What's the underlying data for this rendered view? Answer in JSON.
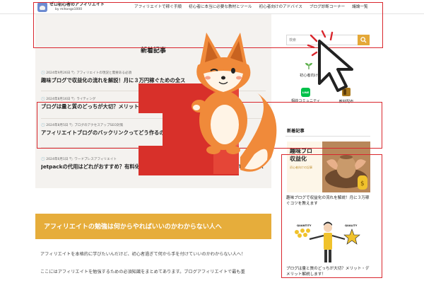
{
  "header": {
    "logo_title": "ゼロ初心者のアフィリエイト",
    "logo_sub": "by mihongo1000",
    "nav": [
      "アフィリエイトで稼ぐ手順",
      "初心者に本当に必要な教材とツール",
      "初心者向けのアドバイス",
      "ブログ診断コーナー",
      "議論一覧"
    ]
  },
  "main": {
    "section_title": "新着記事",
    "articles": [
      {
        "date": "2024年9月26日",
        "category": "アフィリエイトの現況と需要ある必須",
        "title": "趣味ブログで収益化の流れを解説！月に３万円稼ぐための全ス"
      },
      {
        "date": "2024年8月16日",
        "category": "ライティング",
        "title": "ブログは量と質のどっちが大切？メリット・デメリット解説しま"
      },
      {
        "date": "2024年8月5日",
        "category": "ブログのアクセスアップSEO対策",
        "title": "アフィリエイトブログのバックリンクってどう作るの？"
      },
      {
        "date": "2024年6月1日",
        "category": "ワードプレスアフィリエイト",
        "title": "Jetpackの代用はどれがおすすめ？有料化しないとサイト統計情報を見られなくなっている人へ"
      }
    ],
    "banner": "アフィリエイトの勉強は何からやればいいのかわからない人へ",
    "body_text": [
      "アフィリエイトを本格的に学びたいんだけど、初心者過ぎて何から手を付けていいのかわからない人へ！",
      "ここにはアフィリエイトを勉強するための必須知識をまとめてあります。ブログアフィリエイトで最も重"
    ]
  },
  "sidebar": {
    "search_placeholder": "検索",
    "categories": [
      {
        "label": "初心者向け",
        "icon": "sprout-icon"
      },
      {
        "label": "相談コミュニティ",
        "icon": "line-icon",
        "icon_text": "LINE"
      },
      {
        "label": "教材配布",
        "icon": "book-icon"
      }
    ],
    "heading": "新着記事",
    "thumb1": {
      "line1": "趣味ブロ",
      "line2": "収益化",
      "small": "初心者向けの記事"
    },
    "thumb1_title": "趣味ブログで収益化の流れを解説！月に３万稼ぐコツを教えます",
    "thumb2": {
      "left_label": "QUANTITY",
      "right_label": "QUALITY"
    },
    "thumb2_title": "ブログは量と質のどっちが大切？メリット・デメリット解説します！"
  },
  "colors": {
    "accent_orange": "#e6ad3b",
    "annotation_red": "#d9262d",
    "fox_orange": "#f08a3a",
    "line_green": "#00c14a"
  }
}
